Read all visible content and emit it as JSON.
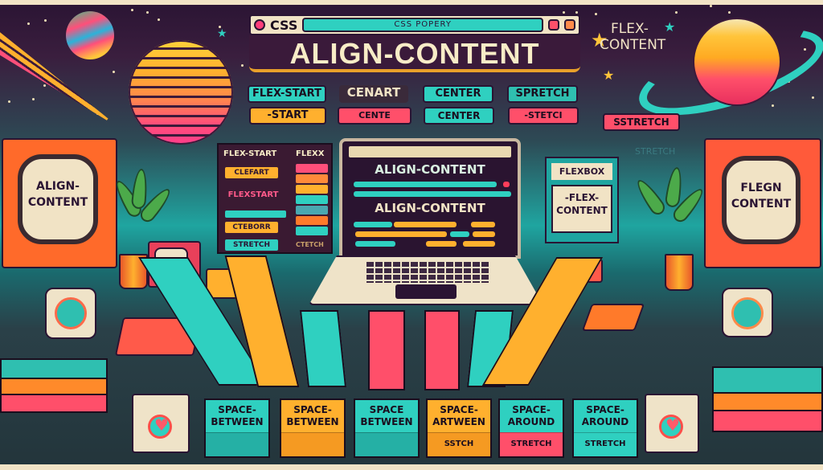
{
  "header": {
    "logo_text": "CSS",
    "url_text": "CSS POPERY",
    "main_title": "ALIGN-CONTENT"
  },
  "top_buttons": {
    "row1": [
      {
        "label": "FLEX-START",
        "color": "#2fd0c0"
      },
      {
        "label": "CENART",
        "color": "#3a2a3a"
      },
      {
        "label": "CENTER",
        "color": "#2fd0c0"
      },
      {
        "label": "SPRETCH",
        "color": "#2fbfb0"
      }
    ],
    "row2": [
      {
        "label": "-START",
        "color": "#ffb02e"
      },
      {
        "label": "CENTE",
        "color": "#ff4f6a"
      },
      {
        "label": "CENTER",
        "color": "#2fd0c0"
      },
      {
        "label": "-STETCI",
        "color": "#ff4f6a"
      }
    ],
    "extra": {
      "label": "SSTRETCH",
      "color": "#ff4f6a"
    },
    "ghost": "STRETCH"
  },
  "corner_text": {
    "line1": "FLEX-",
    "line2": "CONTENT"
  },
  "left_panel": {
    "header_left": "FLEX-START",
    "header_right": "FLEXX",
    "items": [
      {
        "label": "CLEFART",
        "color": "#ffb02e"
      },
      {
        "label": "FLEXSTART",
        "color": "text-pink"
      },
      {
        "label": "",
        "color": "#2fd0c0"
      },
      {
        "label": "CTEBORR",
        "color": "#ffb02e"
      },
      {
        "label": "STRETCH",
        "color": "#2fd0c0"
      }
    ],
    "right_bars": [
      "#ff4f7a",
      "#ff8a3a",
      "#ffb02e",
      "#2fd0c0",
      "#4aa8b0",
      "#ff7a2a",
      "#2fd0c0"
    ],
    "footer_right": "CTETCH"
  },
  "laptop": {
    "heading1": "ALIGN-CONTENT",
    "heading2": "ALIGN-CONTENT"
  },
  "flexbox_card": {
    "title": "FLEXBOX",
    "body_line1": "-FLEX-",
    "body_line2": "CONTENT"
  },
  "tv_left": {
    "line1": "ALIGN-",
    "line2": "CONTENT"
  },
  "tv_right": {
    "line1": "FLEGN",
    "line2": "CONTENT"
  },
  "floor_keys": [
    {
      "color": "#2fd0c0"
    },
    {
      "color": "#ffb02e"
    },
    {
      "color": "#2fd0c0"
    },
    {
      "color": "#ff4f6a"
    },
    {
      "color": "#ff4f6a"
    },
    {
      "color": "#2fd0c0"
    },
    {
      "color": "#ffb02e"
    }
  ],
  "bottom_labels": [
    {
      "line1": "SPACE-",
      "line2": "BETWEEN",
      "sub": "",
      "color": "#2fd0c0",
      "sub_color": "#25b0a5"
    },
    {
      "line1": "SPACE-",
      "line2": "BETWEEN",
      "sub": "",
      "color": "#ffb02e",
      "sub_color": "#f59a22"
    },
    {
      "line1": "SPACE",
      "line2": "BETWEEN",
      "sub": "",
      "color": "#2fd0c0",
      "sub_color": "#25b0a5"
    },
    {
      "line1": "SPACE-",
      "line2": "ARTWEEN",
      "sub": "SSTCH",
      "color": "#ffb02e",
      "sub_color": "#f59a22"
    },
    {
      "line1": "SPACE-",
      "line2": "AROUND",
      "sub": "STRETCH",
      "color": "#2fd0c0",
      "sub_color": "#ff4f6a"
    },
    {
      "line1": "SPACE-",
      "line2": "AROUND",
      "sub": "STRETCH",
      "color": "#2fd0c0",
      "sub_color": "#2fd0c0"
    }
  ]
}
